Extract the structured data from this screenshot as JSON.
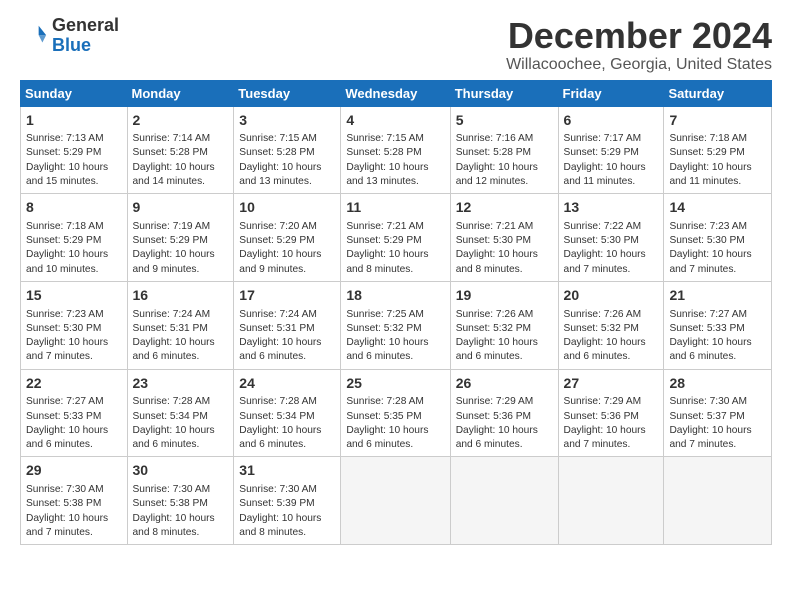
{
  "header": {
    "logo_line1": "General",
    "logo_line2": "Blue",
    "title": "December 2024",
    "location": "Willacoochee, Georgia, United States"
  },
  "days_of_week": [
    "Sunday",
    "Monday",
    "Tuesday",
    "Wednesday",
    "Thursday",
    "Friday",
    "Saturday"
  ],
  "weeks": [
    [
      {
        "day": "1",
        "sunrise": "7:13 AM",
        "sunset": "5:29 PM",
        "daylight": "10 hours and 15 minutes."
      },
      {
        "day": "2",
        "sunrise": "7:14 AM",
        "sunset": "5:28 PM",
        "daylight": "10 hours and 14 minutes."
      },
      {
        "day": "3",
        "sunrise": "7:15 AM",
        "sunset": "5:28 PM",
        "daylight": "10 hours and 13 minutes."
      },
      {
        "day": "4",
        "sunrise": "7:15 AM",
        "sunset": "5:28 PM",
        "daylight": "10 hours and 13 minutes."
      },
      {
        "day": "5",
        "sunrise": "7:16 AM",
        "sunset": "5:28 PM",
        "daylight": "10 hours and 12 minutes."
      },
      {
        "day": "6",
        "sunrise": "7:17 AM",
        "sunset": "5:29 PM",
        "daylight": "10 hours and 11 minutes."
      },
      {
        "day": "7",
        "sunrise": "7:18 AM",
        "sunset": "5:29 PM",
        "daylight": "10 hours and 11 minutes."
      }
    ],
    [
      {
        "day": "8",
        "sunrise": "7:18 AM",
        "sunset": "5:29 PM",
        "daylight": "10 hours and 10 minutes."
      },
      {
        "day": "9",
        "sunrise": "7:19 AM",
        "sunset": "5:29 PM",
        "daylight": "10 hours and 9 minutes."
      },
      {
        "day": "10",
        "sunrise": "7:20 AM",
        "sunset": "5:29 PM",
        "daylight": "10 hours and 9 minutes."
      },
      {
        "day": "11",
        "sunrise": "7:21 AM",
        "sunset": "5:29 PM",
        "daylight": "10 hours and 8 minutes."
      },
      {
        "day": "12",
        "sunrise": "7:21 AM",
        "sunset": "5:30 PM",
        "daylight": "10 hours and 8 minutes."
      },
      {
        "day": "13",
        "sunrise": "7:22 AM",
        "sunset": "5:30 PM",
        "daylight": "10 hours and 7 minutes."
      },
      {
        "day": "14",
        "sunrise": "7:23 AM",
        "sunset": "5:30 PM",
        "daylight": "10 hours and 7 minutes."
      }
    ],
    [
      {
        "day": "15",
        "sunrise": "7:23 AM",
        "sunset": "5:30 PM",
        "daylight": "10 hours and 7 minutes."
      },
      {
        "day": "16",
        "sunrise": "7:24 AM",
        "sunset": "5:31 PM",
        "daylight": "10 hours and 6 minutes."
      },
      {
        "day": "17",
        "sunrise": "7:24 AM",
        "sunset": "5:31 PM",
        "daylight": "10 hours and 6 minutes."
      },
      {
        "day": "18",
        "sunrise": "7:25 AM",
        "sunset": "5:32 PM",
        "daylight": "10 hours and 6 minutes."
      },
      {
        "day": "19",
        "sunrise": "7:26 AM",
        "sunset": "5:32 PM",
        "daylight": "10 hours and 6 minutes."
      },
      {
        "day": "20",
        "sunrise": "7:26 AM",
        "sunset": "5:32 PM",
        "daylight": "10 hours and 6 minutes."
      },
      {
        "day": "21",
        "sunrise": "7:27 AM",
        "sunset": "5:33 PM",
        "daylight": "10 hours and 6 minutes."
      }
    ],
    [
      {
        "day": "22",
        "sunrise": "7:27 AM",
        "sunset": "5:33 PM",
        "daylight": "10 hours and 6 minutes."
      },
      {
        "day": "23",
        "sunrise": "7:28 AM",
        "sunset": "5:34 PM",
        "daylight": "10 hours and 6 minutes."
      },
      {
        "day": "24",
        "sunrise": "7:28 AM",
        "sunset": "5:34 PM",
        "daylight": "10 hours and 6 minutes."
      },
      {
        "day": "25",
        "sunrise": "7:28 AM",
        "sunset": "5:35 PM",
        "daylight": "10 hours and 6 minutes."
      },
      {
        "day": "26",
        "sunrise": "7:29 AM",
        "sunset": "5:36 PM",
        "daylight": "10 hours and 6 minutes."
      },
      {
        "day": "27",
        "sunrise": "7:29 AM",
        "sunset": "5:36 PM",
        "daylight": "10 hours and 7 minutes."
      },
      {
        "day": "28",
        "sunrise": "7:30 AM",
        "sunset": "5:37 PM",
        "daylight": "10 hours and 7 minutes."
      }
    ],
    [
      {
        "day": "29",
        "sunrise": "7:30 AM",
        "sunset": "5:38 PM",
        "daylight": "10 hours and 7 minutes."
      },
      {
        "day": "30",
        "sunrise": "7:30 AM",
        "sunset": "5:38 PM",
        "daylight": "10 hours and 8 minutes."
      },
      {
        "day": "31",
        "sunrise": "7:30 AM",
        "sunset": "5:39 PM",
        "daylight": "10 hours and 8 minutes."
      },
      null,
      null,
      null,
      null
    ]
  ],
  "labels": {
    "sunrise": "Sunrise:",
    "sunset": "Sunset:",
    "daylight": "Daylight:"
  }
}
